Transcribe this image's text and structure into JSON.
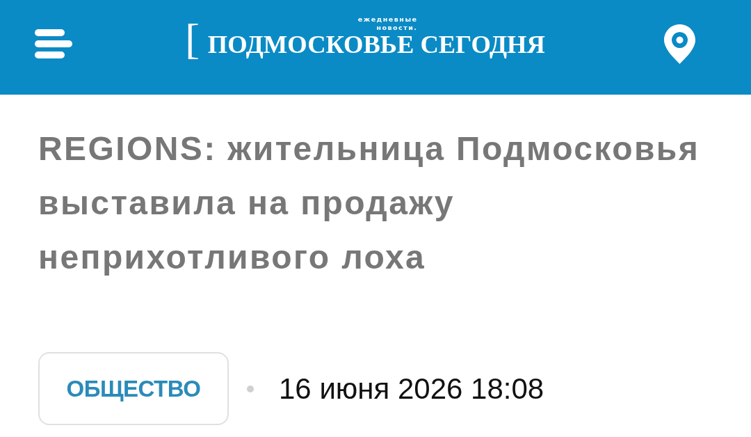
{
  "header": {
    "logo": {
      "bracket": "[",
      "tagline": "ежедневные новости.",
      "title": "ПОДМОСКОВЬЕ СЕГОДНЯ"
    }
  },
  "article": {
    "title": "REGIONS: жительница Подмосковья выставила на продажу неприхотливого лоха",
    "category": "ОБЩЕСТВО",
    "date": "16 июня 2026 18:08"
  }
}
